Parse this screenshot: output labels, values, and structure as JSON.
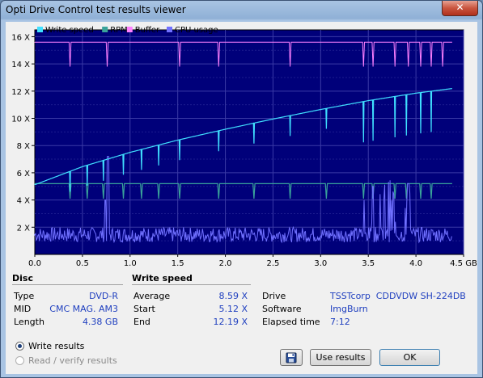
{
  "window": {
    "title": "Opti Drive Control test results viewer",
    "close_glyph": "✕"
  },
  "chart_data": {
    "type": "line",
    "legend": [
      {
        "name": "Write speed",
        "color": "#40e0ff"
      },
      {
        "name": "RPM",
        "color": "#3aa39a"
      },
      {
        "name": "Buffer",
        "color": "#ff80ff"
      },
      {
        "name": "CPU usage",
        "color": "#7070ff"
      }
    ],
    "ylabels": [
      "2 X",
      "4 X",
      "6 X",
      "8 X",
      "10 X",
      "12 X",
      "14 X",
      "16 X"
    ],
    "xlabels": [
      "0.0",
      "0.5",
      "1.0",
      "1.5",
      "2.0",
      "2.5",
      "3.0",
      "3.5",
      "4.0",
      "4.5 GB"
    ],
    "xlim": [
      0,
      4.5
    ],
    "ylim": [
      0,
      16.5
    ],
    "grid": true,
    "background": "#00007a",
    "series": [
      {
        "name": "Write speed",
        "x": [
          0,
          0.5,
          1.0,
          1.5,
          2.0,
          2.5,
          3.0,
          3.5,
          4.0,
          4.38
        ],
        "values": [
          5.12,
          6.45,
          7.5,
          8.4,
          9.2,
          9.95,
          10.65,
          11.3,
          11.85,
          12.19
        ]
      },
      {
        "name": "RPM",
        "x": [
          0,
          4.38
        ],
        "values": [
          5.2,
          5.2
        ]
      },
      {
        "name": "Buffer",
        "x": [
          0,
          4.38
        ],
        "values": [
          15.6,
          15.6
        ]
      },
      {
        "name": "CPU usage",
        "x": [
          0,
          0.75,
          0.76,
          3.45,
          3.5,
          3.9,
          4.38
        ],
        "values": [
          1.5,
          1.8,
          7.2,
          1.5,
          5.0,
          5.2,
          1.2
        ]
      }
    ]
  },
  "disc": {
    "header": "Disc",
    "rows": [
      {
        "label": "Type",
        "value": "DVD-R"
      },
      {
        "label": "MID",
        "value": "CMC MAG. AM3"
      },
      {
        "label": "Length",
        "value": "4.38 GB"
      }
    ]
  },
  "write_speed": {
    "header": "Write speed",
    "rows": [
      {
        "label": "Average",
        "value": "8.59 X"
      },
      {
        "label": "Start",
        "value": "5.12 X"
      },
      {
        "label": "End",
        "value": "12.19 X"
      }
    ]
  },
  "drive_info": {
    "rows": [
      {
        "label": "Drive",
        "value": "TSSTcorp  CDDVDW SH-224DB"
      },
      {
        "label": "Software",
        "value": "ImgBurn"
      },
      {
        "label": "Elapsed time",
        "value": "7:12"
      }
    ]
  },
  "results_mode": {
    "write_label": "Write results",
    "read_label": "Read / verify results",
    "selected": "write"
  },
  "buttons": {
    "use_results": "Use results",
    "ok": "OK"
  }
}
